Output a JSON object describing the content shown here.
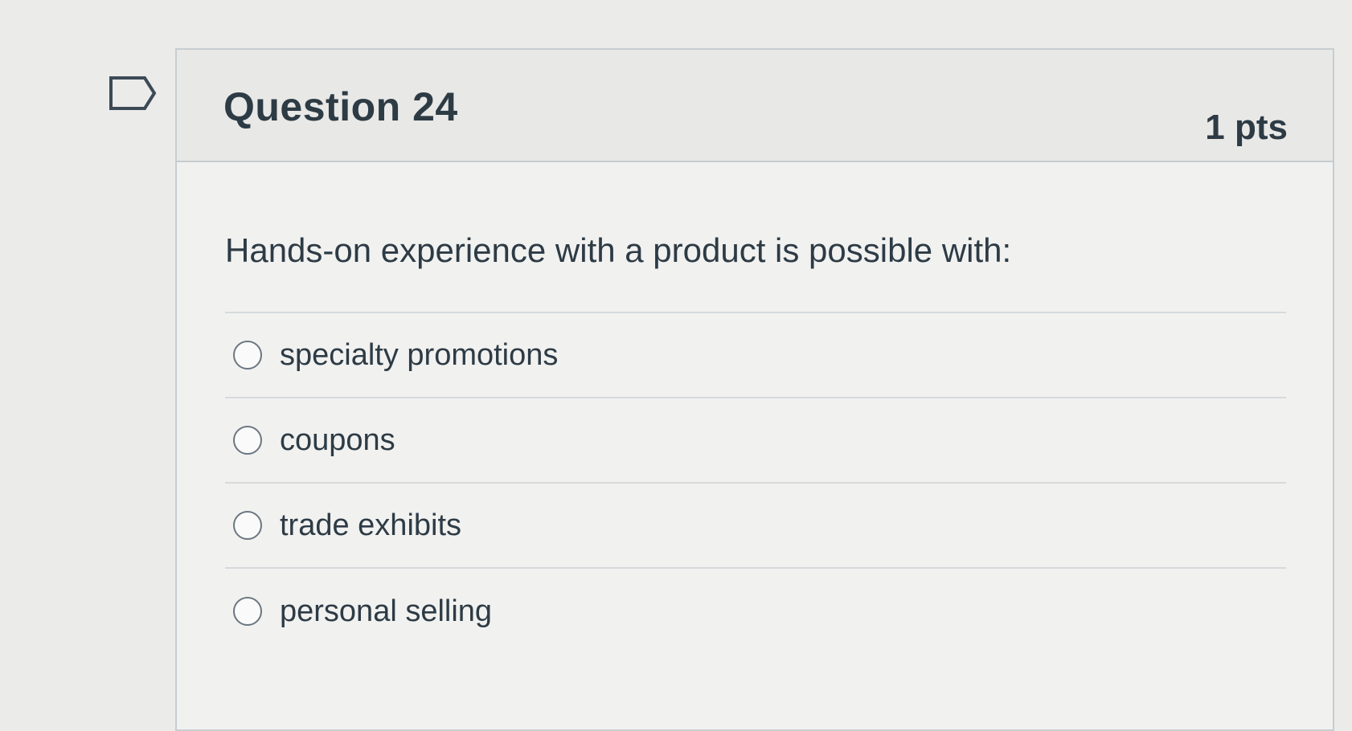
{
  "question": {
    "title": "Question 24",
    "points": "1 pts",
    "text": "Hands-on experience with a product is possible with:",
    "flag_icon": "flag-outline-icon",
    "answers": [
      {
        "label": "specialty promotions",
        "selected": false
      },
      {
        "label": "coupons",
        "selected": false
      },
      {
        "label": "trade exhibits",
        "selected": false
      },
      {
        "label": "personal selling",
        "selected": false
      }
    ]
  },
  "colors": {
    "background": "#ebebea",
    "text": "#2d3b45",
    "border": "#c7cdd1"
  }
}
